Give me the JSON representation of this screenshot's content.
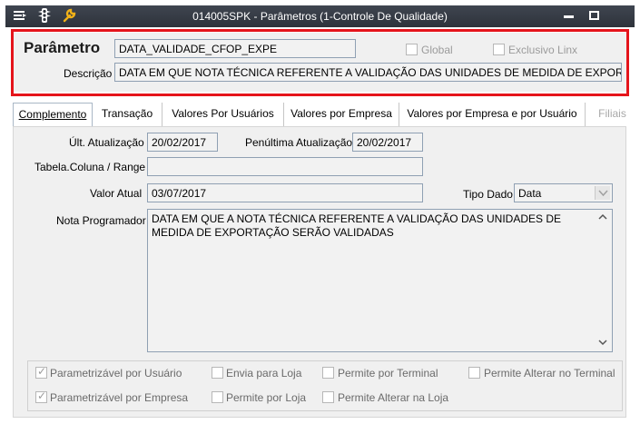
{
  "window": {
    "title": "014005SPK - Parâmetros (1-Controle De Qualidade)",
    "highlight_color": "#e5141b"
  },
  "header": {
    "parametro_label": "Parâmetro",
    "parametro_value": "DATA_VALIDADE_CFOP_EXPE",
    "global_label": "Global",
    "exclusivo_label": "Exclusivo Linx",
    "descricao_label": "Descrição",
    "descricao_value": "DATA EM QUE NOTA TÉCNICA REFERENTE A VALIDAÇÃO DAS UNIDADES DE MEDIDA DE EXPORTAÇÃO S"
  },
  "tabs": [
    {
      "label": "Complemento",
      "active": true
    },
    {
      "label": "Transação"
    },
    {
      "label": "Valores Por Usuários"
    },
    {
      "label": "Valores por Empresa"
    },
    {
      "label": "Valores por Empresa e por Usuário"
    },
    {
      "label": "Filiais",
      "disabled": true
    }
  ],
  "form": {
    "ult_atualizacao_label": "Últ. Atualização",
    "ult_atualizacao_value": "20/02/2017",
    "penultima_label": "Penúltima Atualização",
    "penultima_value": "20/02/2017",
    "tabela_label": "Tabela.Coluna / Range",
    "tabela_value": "",
    "valor_atual_label": "Valor Atual",
    "valor_atual_value": "03/07/2017",
    "tipo_dado_label": "Tipo Dado",
    "tipo_dado_value": "Data",
    "nota_label": "Nota Programador",
    "nota_value": "DATA EM QUE A NOTA TÉCNICA REFERENTE A VALIDAÇÃO DAS UNIDADES DE MEDIDA DE EXPORTAÇÃO SERÃO VALIDADAS"
  },
  "checks": {
    "param_usuario": {
      "label": "Parametrizável por Usuário",
      "checked": true
    },
    "envia_loja": {
      "label": "Envia para Loja",
      "checked": false
    },
    "permite_terminal": {
      "label": "Permite por Terminal",
      "checked": false
    },
    "permite_alterar_terminal": {
      "label": "Permite Alterar no Terminal",
      "checked": false
    },
    "param_empresa": {
      "label": "Parametrizável por Empresa",
      "checked": true
    },
    "permite_loja": {
      "label": "Permite por Loja",
      "checked": false
    },
    "permite_alterar_loja": {
      "label": "Permite Alterar na Loja",
      "checked": false
    }
  }
}
